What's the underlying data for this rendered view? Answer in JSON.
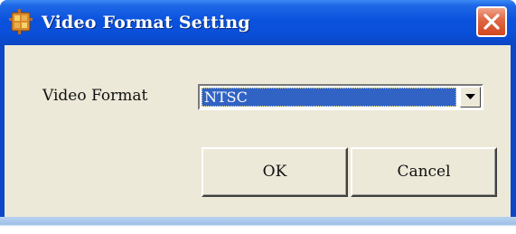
{
  "window": {
    "title": "Video Format Setting",
    "title_icon": "app-icon",
    "close_icon": "close-icon"
  },
  "form": {
    "video_format_label": "Video Format",
    "video_format_value": "NTSC",
    "dropdown_icon": "chevron-down-icon"
  },
  "buttons": {
    "ok_label": "OK",
    "cancel_label": "Cancel"
  },
  "colors": {
    "title_bar": "#0a52de",
    "dialog_body": "#ece9d8",
    "selection": "#3163c5",
    "close_button": "#d2461e"
  }
}
